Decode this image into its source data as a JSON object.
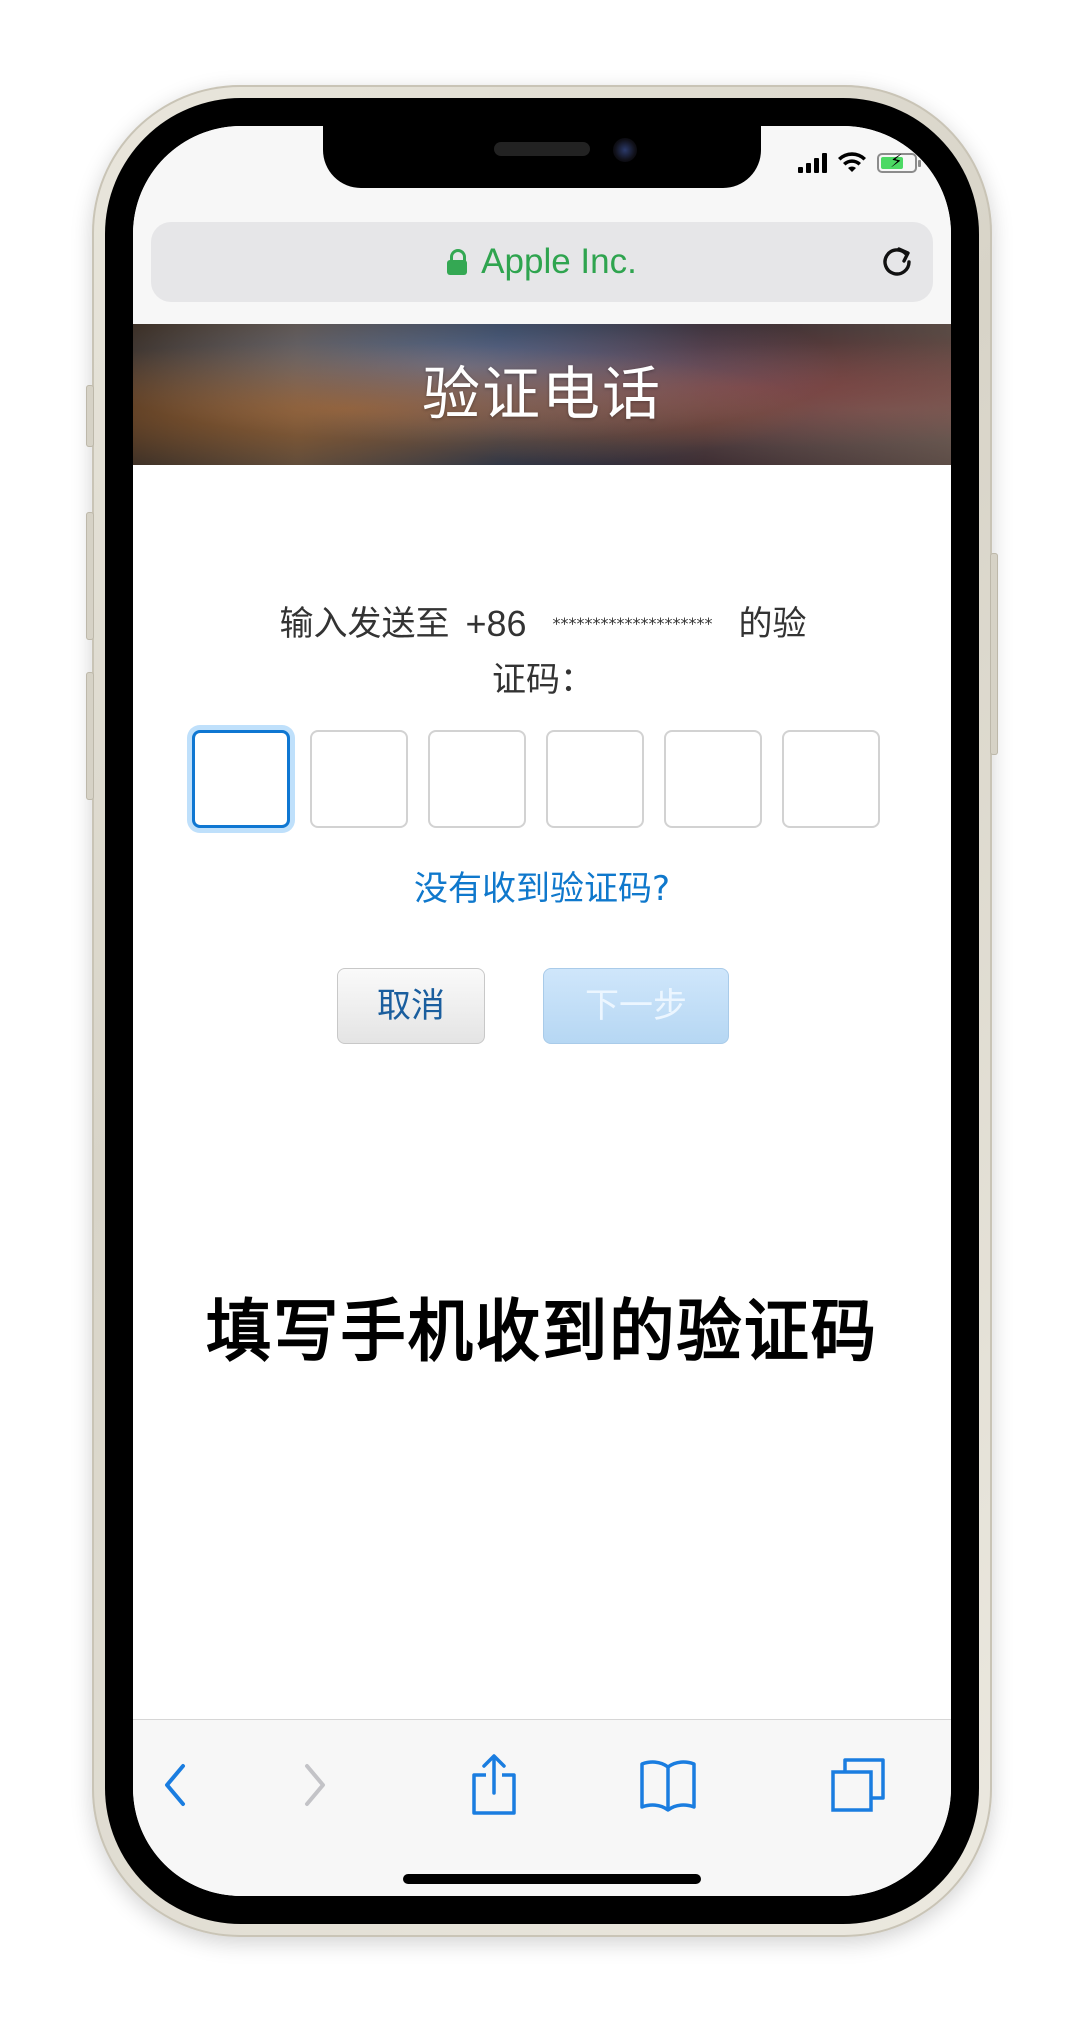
{
  "browser": {
    "url_label": "Apple Inc."
  },
  "page": {
    "banner_title": "验证电话",
    "prompt_prefix": "输入发送至",
    "country_code": "+86",
    "masked_number": "********************",
    "prompt_suffix_line1": "的验",
    "prompt_line2": "证码：",
    "code_digits": [
      "",
      "",
      "",
      "",
      "",
      ""
    ],
    "resend_link": "没有收到验证码?",
    "cancel_button": "取消",
    "next_button": "下一步"
  },
  "caption": "填写手机收到的验证码",
  "colors": {
    "link_blue": "#0f78cc",
    "secure_green": "#2fa44f",
    "active_box_border": "#0f77d2",
    "next_button_disabled": "#b6d7f3"
  },
  "toolbar": {
    "icons": [
      "back-icon",
      "forward-icon",
      "share-icon",
      "bookmarks-icon",
      "tabs-icon"
    ]
  }
}
